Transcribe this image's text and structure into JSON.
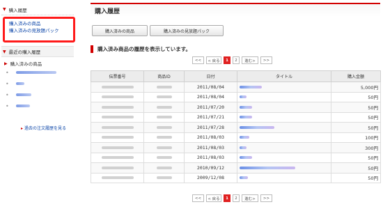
{
  "sidebar": {
    "history_heading": "購入履歴",
    "links": [
      {
        "label": "購入済みの商品"
      },
      {
        "label": "購入済みの見放題パック"
      }
    ],
    "recent_heading": "最近の購入履歴",
    "recent_category": "購入済みの商品",
    "more_link": "過去の注文履歴を見る"
  },
  "main": {
    "title": "購入履歴",
    "tabs": [
      {
        "label": "購入済みの商品"
      },
      {
        "label": "購入済みの見放題パック"
      }
    ],
    "section_heading": "購入済み商品の履歴を表示しています。",
    "pager": {
      "first": "<<",
      "prev": "< 戻る",
      "pages": [
        "1",
        "2"
      ],
      "current": "1",
      "next": "進む>",
      "last": ">>"
    },
    "table": {
      "headers": [
        "伝票番号",
        "商品ID",
        "日付",
        "タイトル",
        "購入金額"
      ],
      "rows": [
        {
          "date": "2011/08/04",
          "price": "5,000円"
        },
        {
          "date": "2011/08/04",
          "price": "50円"
        },
        {
          "date": "2011/07/20",
          "price": "50円"
        },
        {
          "date": "2011/07/21",
          "price": "50円"
        },
        {
          "date": "2011/07/28",
          "price": "50円"
        },
        {
          "date": "2011/08/03",
          "price": "100円"
        },
        {
          "date": "2011/08/03",
          "price": "300円"
        },
        {
          "date": "2011/08/03",
          "price": "50円"
        },
        {
          "date": "2010/09/12",
          "price": "50円"
        },
        {
          "date": "2009/12/08",
          "price": "50円"
        }
      ]
    }
  },
  "colors": {
    "accent": "#d20000",
    "link": "#0b45a8",
    "highlight_box": "#ff1a1a",
    "pager_current": "#e02020"
  },
  "icons": {
    "section_marker": "red-triangle-icon"
  }
}
